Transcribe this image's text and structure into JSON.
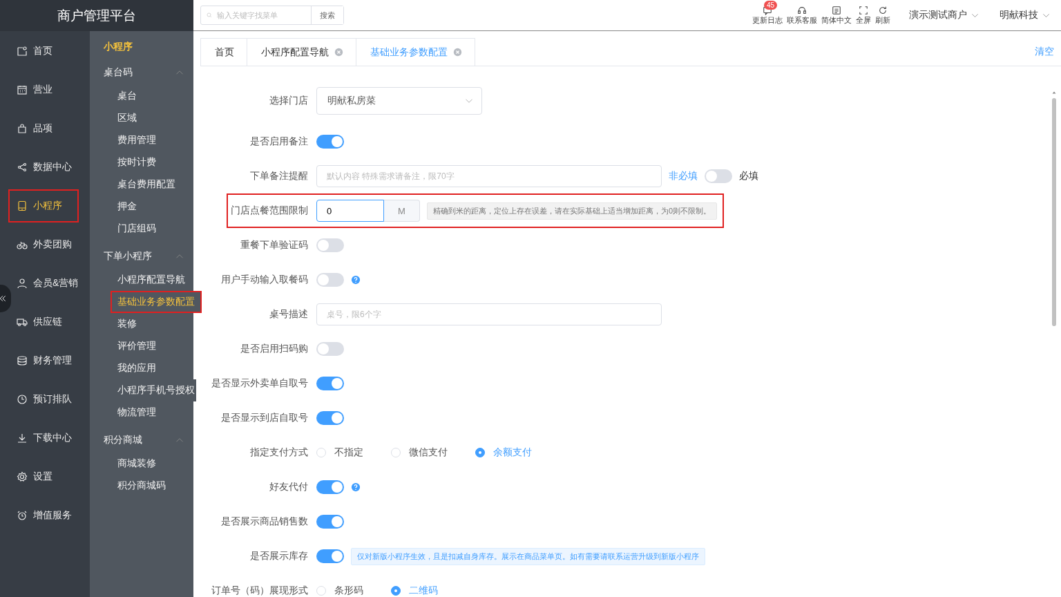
{
  "brand": "商户管理平台",
  "search": {
    "placeholder": "输入关键字找菜单",
    "button": "搜索"
  },
  "toolbar": [
    {
      "label": "更新日志",
      "badge": "45"
    },
    {
      "label": "联系客服"
    },
    {
      "label": "简体中文"
    },
    {
      "label": "全屏"
    },
    {
      "label": "刷新"
    }
  ],
  "account_menus": [
    "演示测试商户",
    "明献科技"
  ],
  "nav": [
    {
      "label": "首页",
      "selected": false,
      "highlighted": false
    },
    {
      "label": "营业",
      "selected": false,
      "highlighted": false
    },
    {
      "label": "品项",
      "selected": false,
      "highlighted": false
    },
    {
      "label": "数据中心",
      "selected": false,
      "highlighted": false
    },
    {
      "label": "小程序",
      "selected": true,
      "highlighted": true
    },
    {
      "label": "外卖团购",
      "selected": false,
      "highlighted": false
    },
    {
      "label": "会员&营销",
      "selected": false,
      "highlighted": false
    },
    {
      "label": "供应链",
      "selected": false,
      "highlighted": false
    },
    {
      "label": "财务管理",
      "selected": false,
      "highlighted": false
    },
    {
      "label": "预订排队",
      "selected": false,
      "highlighted": false
    },
    {
      "label": "下载中心",
      "selected": false,
      "highlighted": false
    },
    {
      "label": "设置",
      "selected": false,
      "highlighted": false
    },
    {
      "label": "增值服务",
      "selected": false,
      "highlighted": false
    }
  ],
  "submenu": {
    "title": "小程序",
    "groups": [
      {
        "label": "桌台码",
        "expanded": true,
        "children": [
          {
            "label": "桌台",
            "selected": false,
            "highlighted": false
          },
          {
            "label": "区域",
            "selected": false,
            "highlighted": false
          },
          {
            "label": "费用管理",
            "selected": false,
            "highlighted": false
          },
          {
            "label": "按时计费",
            "selected": false,
            "highlighted": false
          },
          {
            "label": "桌台费用配置",
            "selected": false,
            "highlighted": false
          },
          {
            "label": "押金",
            "selected": false,
            "highlighted": false
          },
          {
            "label": "门店组码",
            "selected": false,
            "highlighted": false
          }
        ]
      },
      {
        "label": "下单小程序",
        "expanded": true,
        "children": [
          {
            "label": "小程序配置导航",
            "selected": false,
            "highlighted": false
          },
          {
            "label": "基础业务参数配置",
            "selected": true,
            "highlighted": true
          },
          {
            "label": "装修",
            "selected": false,
            "highlighted": false
          },
          {
            "label": "评价管理",
            "selected": false,
            "highlighted": false
          },
          {
            "label": "我的应用",
            "selected": false,
            "highlighted": false
          },
          {
            "label": "小程序手机号授权",
            "selected": false,
            "highlighted": false
          },
          {
            "label": "物流管理",
            "selected": false,
            "highlighted": false
          }
        ]
      },
      {
        "label": "积分商城",
        "expanded": true,
        "children": [
          {
            "label": "商城装修",
            "selected": false,
            "highlighted": false
          },
          {
            "label": "积分商城码",
            "selected": false,
            "highlighted": false
          }
        ]
      }
    ]
  },
  "tabs": [
    {
      "label": "首页",
      "selected": false,
      "closable": false
    },
    {
      "label": "小程序配置导航",
      "selected": false,
      "closable": true
    },
    {
      "label": "基础业务参数配置",
      "selected": true,
      "closable": true
    }
  ],
  "clear_button": "清空",
  "form": [
    {
      "label": "选择门店",
      "kind": "select",
      "value": "明献私房菜",
      "highlighted": false
    },
    {
      "label": "是否启用备注",
      "kind": "switch",
      "on": true,
      "highlighted": false
    },
    {
      "label": "下单备注提醒",
      "kind": "text",
      "placeholder": "默认内容 特殊需求请备注，限70字",
      "required_switch": {
        "off_label": "非必填",
        "on": false,
        "on_label": "必填"
      },
      "highlighted": false
    },
    {
      "label": "门店点餐范围限制",
      "kind": "number",
      "value": "0",
      "unit": "M",
      "hint": "精确到米的距离，定位上存在误差，请在实际基础上适当增加距离，为0则不限制。",
      "highlighted": true
    },
    {
      "label": "重餐下单验证码",
      "kind": "switch",
      "on": false,
      "highlighted": false
    },
    {
      "label": "用户手动输入取餐码",
      "kind": "switch",
      "on": false,
      "help": true,
      "highlighted": false
    },
    {
      "label": "桌号描述",
      "kind": "text",
      "placeholder": "桌号，限6个字",
      "highlighted": false
    },
    {
      "label": "是否启用扫码购",
      "kind": "switch",
      "on": false,
      "highlighted": false
    },
    {
      "label": "是否显示外卖单自取号",
      "kind": "switch",
      "on": true,
      "highlighted": false
    },
    {
      "label": "是否显示到店自取号",
      "kind": "switch",
      "on": true,
      "highlighted": false
    },
    {
      "label": "指定支付方式",
      "kind": "radio",
      "options": [
        {
          "label": "不指定",
          "selected": false
        },
        {
          "label": "微信支付",
          "selected": false
        },
        {
          "label": "余额支付",
          "selected": true
        }
      ],
      "highlighted": false
    },
    {
      "label": "好友代付",
      "kind": "switch",
      "on": true,
      "help": true,
      "highlighted": false
    },
    {
      "label": "是否展示商品销售数",
      "kind": "switch",
      "on": true,
      "highlighted": false
    },
    {
      "label": "是否展示库存",
      "kind": "switch",
      "on": true,
      "note": "仅对新版小程序生效，且是扣减自身库存。展示在商品菜单页。如有需要请联系运营升级到新版小程序",
      "highlighted": false
    },
    {
      "label": "订单号（码）展现形式",
      "kind": "radio",
      "options": [
        {
          "label": "条形码",
          "selected": false
        },
        {
          "label": "二维码",
          "selected": true
        }
      ],
      "highlighted": false
    }
  ]
}
